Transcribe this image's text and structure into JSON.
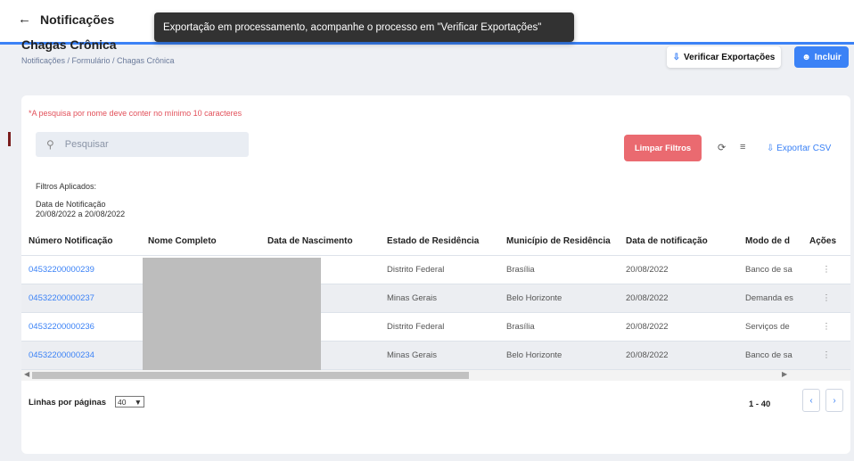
{
  "header": {
    "back_label": "Notificações"
  },
  "toast": {
    "message": "Exportação em processamento, acompanhe o processo em \"Verificar Exportações\""
  },
  "page": {
    "title": "Chagas Crônica",
    "breadcrumb": "Notificações / Formulário / Chagas Crônica"
  },
  "actions": {
    "verify_label": "Verificar Exportações",
    "include_label": "Incluir"
  },
  "card": {
    "warning": "*A pesquisa por nome deve conter no mínimo 10 caracteres",
    "search_placeholder": "Pesquisar",
    "clear_filters_label": "Limpar Filtros",
    "export_csv_label": "Exportar CSV",
    "filters_applied_label": "Filtros Aplicados:",
    "filter_name": "Data de Notificação",
    "filter_value": "20/08/2022 a 20/08/2022"
  },
  "table": {
    "headers": [
      "Número Notificação",
      "Nome Completo",
      "Data de Nascimento",
      "Estado de Residência",
      "Município de Residência",
      "Data de notificação",
      "Modo de d",
      "Ações"
    ],
    "rows": [
      [
        "04532200000239",
        "",
        "",
        "Distrito Federal",
        "Brasília",
        "20/08/2022",
        "Banco de sa"
      ],
      [
        "04532200000237",
        "",
        "",
        "Minas Gerais",
        "Belo Horizonte",
        "20/08/2022",
        "Demanda es"
      ],
      [
        "04532200000236",
        "",
        "",
        "Distrito Federal",
        "Brasília",
        "20/08/2022",
        "Serviços de"
      ],
      [
        "04532200000234",
        "",
        "",
        "Minas Gerais",
        "Belo Horizonte",
        "20/08/2022",
        "Banco de sa"
      ]
    ]
  },
  "pagination": {
    "rows_label": "Linhas por páginas",
    "rows_value": "40",
    "range": "1 - 40"
  },
  "colors": {
    "primary": "#3b82f6",
    "danger": "#ea6a70",
    "toast": "#323232"
  }
}
